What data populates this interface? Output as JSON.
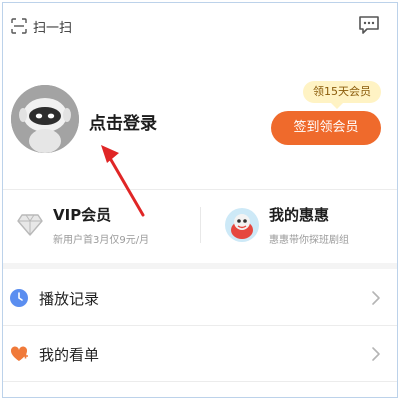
{
  "header": {
    "scan_label": "扫一扫",
    "scan_icon": "scan-icon",
    "message_icon": "message-icon"
  },
  "profile": {
    "avatar_icon": "robot-avatar",
    "login_label": "点击登录",
    "bubble_label": "领15天会员",
    "checkin_label": "签到领会员",
    "accent_color": "#ef6a2c"
  },
  "vip": {
    "title": "VIP会员",
    "subtitle": "新用户首3月仅9元/月",
    "icon": "diamond-icon"
  },
  "huihui": {
    "title": "我的惠惠",
    "subtitle": "惠惠带你探班剧组",
    "icon": "huihui-mascot-icon"
  },
  "list": [
    {
      "label": "播放记录",
      "icon": "clock-icon"
    },
    {
      "label": "我的看单",
      "icon": "heart-plus-icon"
    }
  ]
}
